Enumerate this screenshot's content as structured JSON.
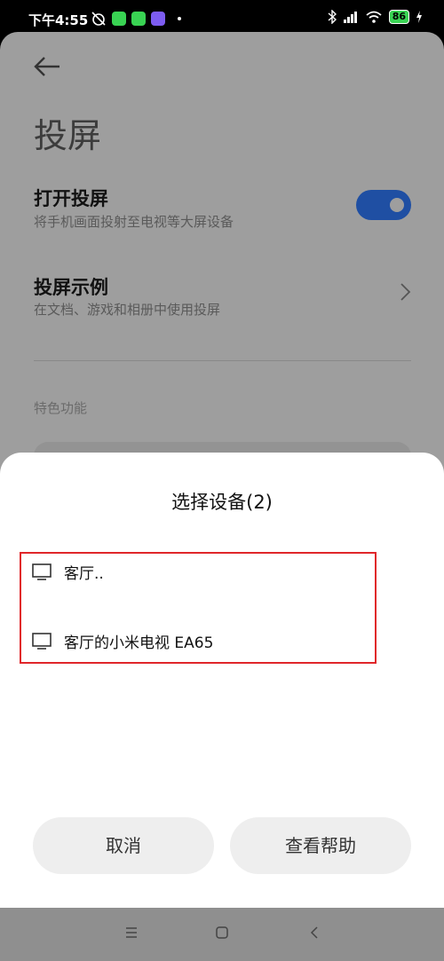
{
  "status_bar": {
    "time": "下午4:55",
    "battery": "86",
    "app_colors": [
      "#39d353",
      "#39d353",
      "#7c5cf0"
    ]
  },
  "page": {
    "title": "投屏",
    "rows": [
      {
        "title": "打开投屏",
        "subtitle": "将手机画面投射至电视等大屏设备",
        "control": "toggle",
        "on": true
      },
      {
        "title": "投屏示例",
        "subtitle": "在文档、游戏和相册中使用投屏",
        "control": "chevron-right-icon"
      }
    ],
    "section_label": "特色功能"
  },
  "sheet": {
    "title": "选择设备(2)",
    "devices": [
      {
        "name": "客厅.."
      },
      {
        "name": "客厅的小米电视 EA65"
      }
    ],
    "buttons": {
      "cancel": "取消",
      "help": "查看帮助"
    }
  },
  "colors": {
    "toggle_on": "#1f4fa3",
    "highlight_border": "#e0262a",
    "sheet_bg": "#ffffff",
    "dim_bg": "#9e9e9e"
  }
}
